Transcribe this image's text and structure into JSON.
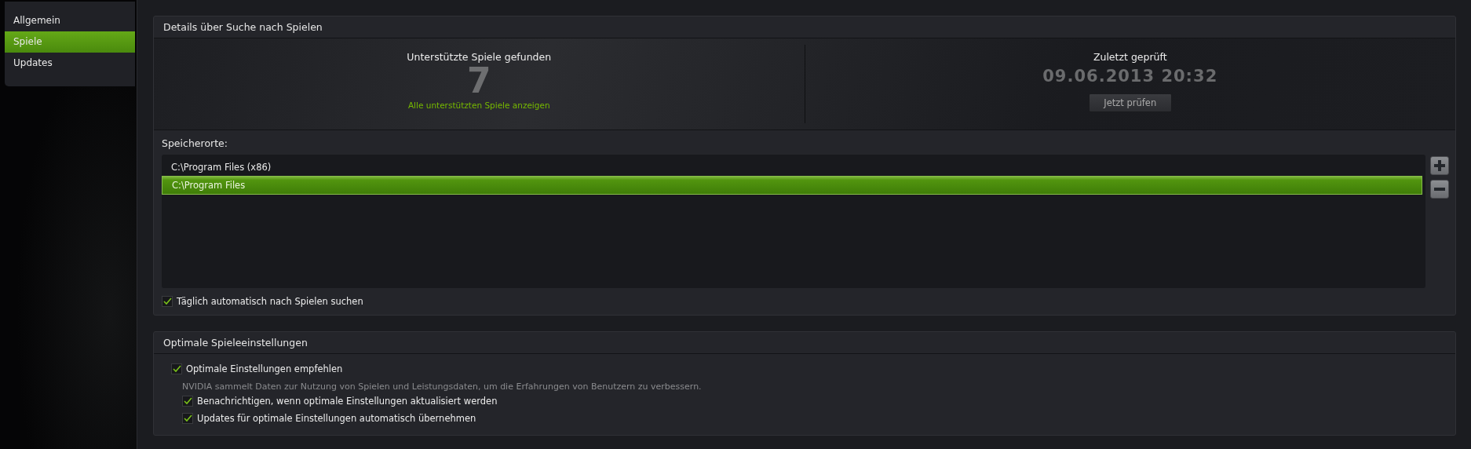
{
  "sidebar": {
    "items": [
      {
        "label": "Allgemein",
        "selected": false
      },
      {
        "label": "Spiele",
        "selected": true
      },
      {
        "label": "Updates",
        "selected": false
      }
    ]
  },
  "scan_panel": {
    "title": "Details über Suche nach Spielen",
    "found": {
      "heading": "Unterstützte Spiele gefunden",
      "count": "7",
      "link": "Alle unterstützten Spiele anzeigen"
    },
    "last_checked": {
      "heading": "Zuletzt geprüft",
      "timestamp": "09.06.2013 20:32",
      "button": "Jetzt prüfen"
    },
    "locations_label": "Speicherorte:",
    "locations": [
      {
        "path": "C:\\Program Files (x86)",
        "selected": false
      },
      {
        "path": "C:\\Program Files",
        "selected": true
      }
    ],
    "auto_scan": {
      "label": "Täglich automatisch nach Spielen suchen",
      "checked": true
    }
  },
  "settings_panel": {
    "title": "Optimale Spieleeinstellungen",
    "options": [
      {
        "label": "Optimale Einstellungen empfehlen",
        "checked": true,
        "note": "NVIDIA sammelt Daten zur Nutzung von Spielen und Leistungsdaten, um die Erfahrungen von Benutzern zu verbessern.",
        "children": [
          {
            "label": "Benachrichtigen, wenn optimale Einstellungen aktualisiert werden",
            "checked": true
          },
          {
            "label": "Updates für optimale Einstellungen automatisch übernehmen",
            "checked": true
          }
        ]
      }
    ]
  }
}
